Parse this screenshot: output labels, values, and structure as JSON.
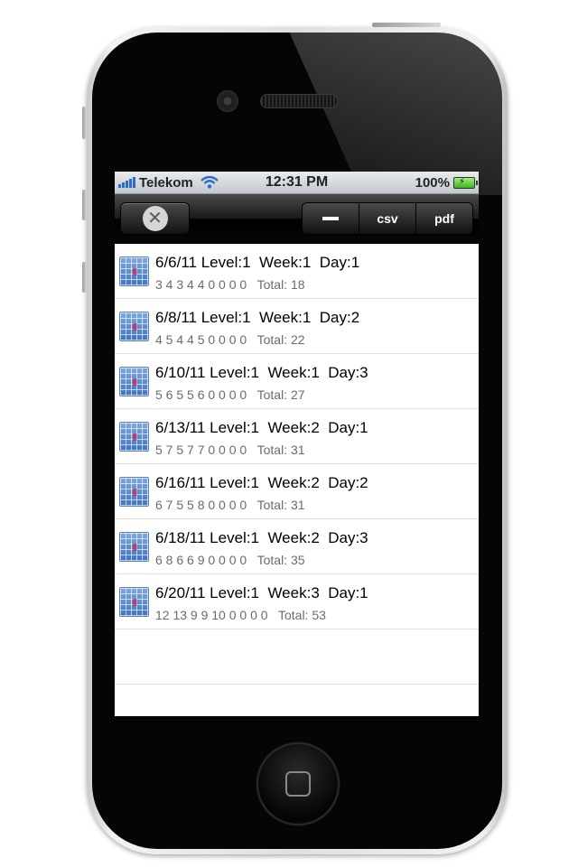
{
  "status_bar": {
    "carrier": "Telekom",
    "time": "12:31 PM",
    "battery": "100%",
    "icons": [
      "signal-icon",
      "wifi-icon",
      "battery-icon"
    ]
  },
  "toolbar": {
    "close_icon": "close-icon",
    "close_glyph": "✕",
    "segments": [
      {
        "icon": "minus-icon"
      },
      {
        "label": "csv"
      },
      {
        "label": "pdf"
      }
    ]
  },
  "rows": [
    {
      "title": "6/6/11 Level:1  Week:1  Day:1",
      "values": "3 4 3 4 4 0 0 0 0",
      "total": "Total: 18"
    },
    {
      "title": "6/8/11 Level:1  Week:1  Day:2",
      "values": "4 5 4 4 5 0 0 0 0",
      "total": "Total: 22"
    },
    {
      "title": "6/10/11 Level:1  Week:1  Day:3",
      "values": "5 6 5 5 6 0 0 0 0",
      "total": "Total: 27"
    },
    {
      "title": "6/13/11 Level:1  Week:2  Day:1",
      "values": "5 7 5 7 7 0 0 0 0",
      "total": "Total: 31"
    },
    {
      "title": "6/16/11 Level:1  Week:2  Day:2",
      "values": "6 7 5 5 8 0 0 0 0",
      "total": "Total: 31"
    },
    {
      "title": "6/18/11 Level:1  Week:2  Day:3",
      "values": "6 8 6 6 9 0 0 0 0",
      "total": "Total: 35"
    },
    {
      "title": "6/20/11 Level:1  Week:3  Day:1",
      "values": "12 13 9 9 10 0 0 0 0",
      "total": "Total: 53"
    }
  ],
  "colors": {
    "toolbar": "#1a1a1a",
    "status_bar": "#d2d6da",
    "row_title": "#000000",
    "row_subtitle": "#6b6b6b",
    "icon_blue": "#3d74c2"
  }
}
